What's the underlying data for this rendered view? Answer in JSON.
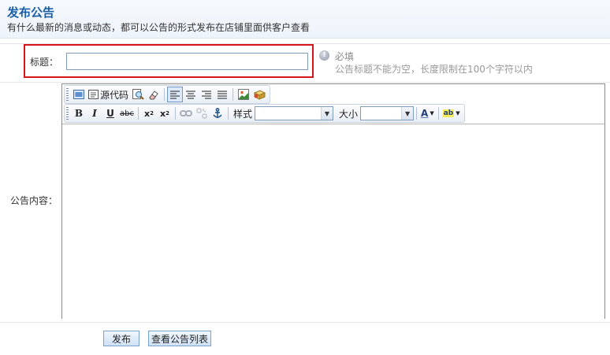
{
  "header": {
    "title": "发布公告",
    "subtitle": "有什么最新的消息或动态，都可以公告的形式发布在店铺里面供客户查看"
  },
  "form": {
    "title_label": "标题：",
    "title_value": "",
    "required_text": "必填",
    "hint_text": "公告标题不能为空，长度限制在100个字符以内",
    "content_label": "公告内容："
  },
  "toolbar": {
    "source_label": "源代码",
    "style_label": "样式",
    "size_label": "大小",
    "style_value": "",
    "size_value": "",
    "font_color_glyph": "A",
    "highlight_glyph": "ab"
  },
  "buttons": {
    "publish": "发布",
    "view_list": "查看公告列表"
  },
  "colors": {
    "title_blue": "#1b5ea8",
    "highlight_red": "#d6151b"
  }
}
